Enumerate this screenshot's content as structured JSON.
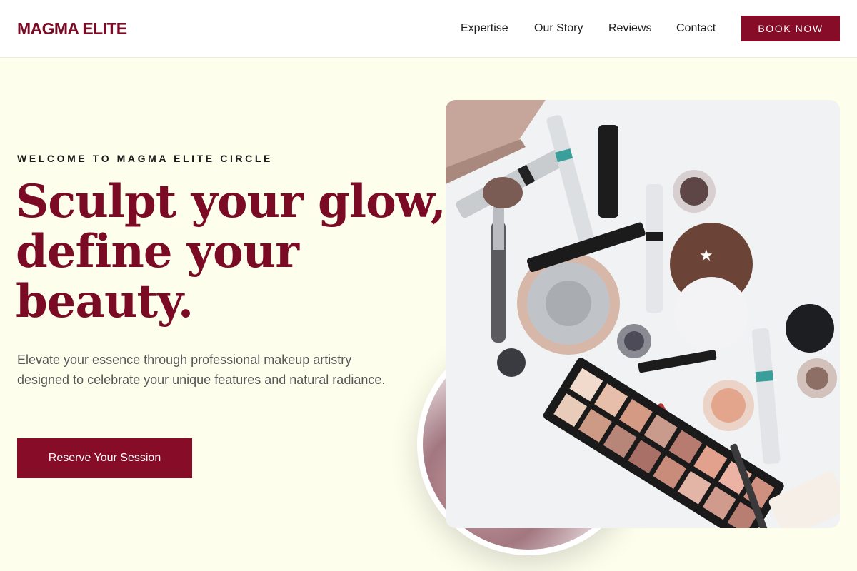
{
  "brand": {
    "name": "MAGMA ELITE",
    "color": "#7b0a24"
  },
  "nav": {
    "items": [
      {
        "label": "Expertise"
      },
      {
        "label": "Our Story"
      },
      {
        "label": "Reviews"
      },
      {
        "label": "Contact"
      }
    ],
    "book_label": "BOOK NOW"
  },
  "hero": {
    "eyebrow": "WELCOME TO MAGMA ELITE CIRCLE",
    "headline": [
      "Sculpt your glow,",
      "define your",
      "beauty."
    ],
    "subtext": "Elevate your essence through professional makeup artistry designed to celebrate your unique features and natural radiance.",
    "cta_label": "Reserve Your Session"
  },
  "images": {
    "main_photo": "makeup-products-flatlay",
    "circle_photo": "makeup-application-closeup"
  },
  "colors": {
    "accent": "#860c28",
    "background": "#fefeed",
    "header": "#ffffff"
  }
}
